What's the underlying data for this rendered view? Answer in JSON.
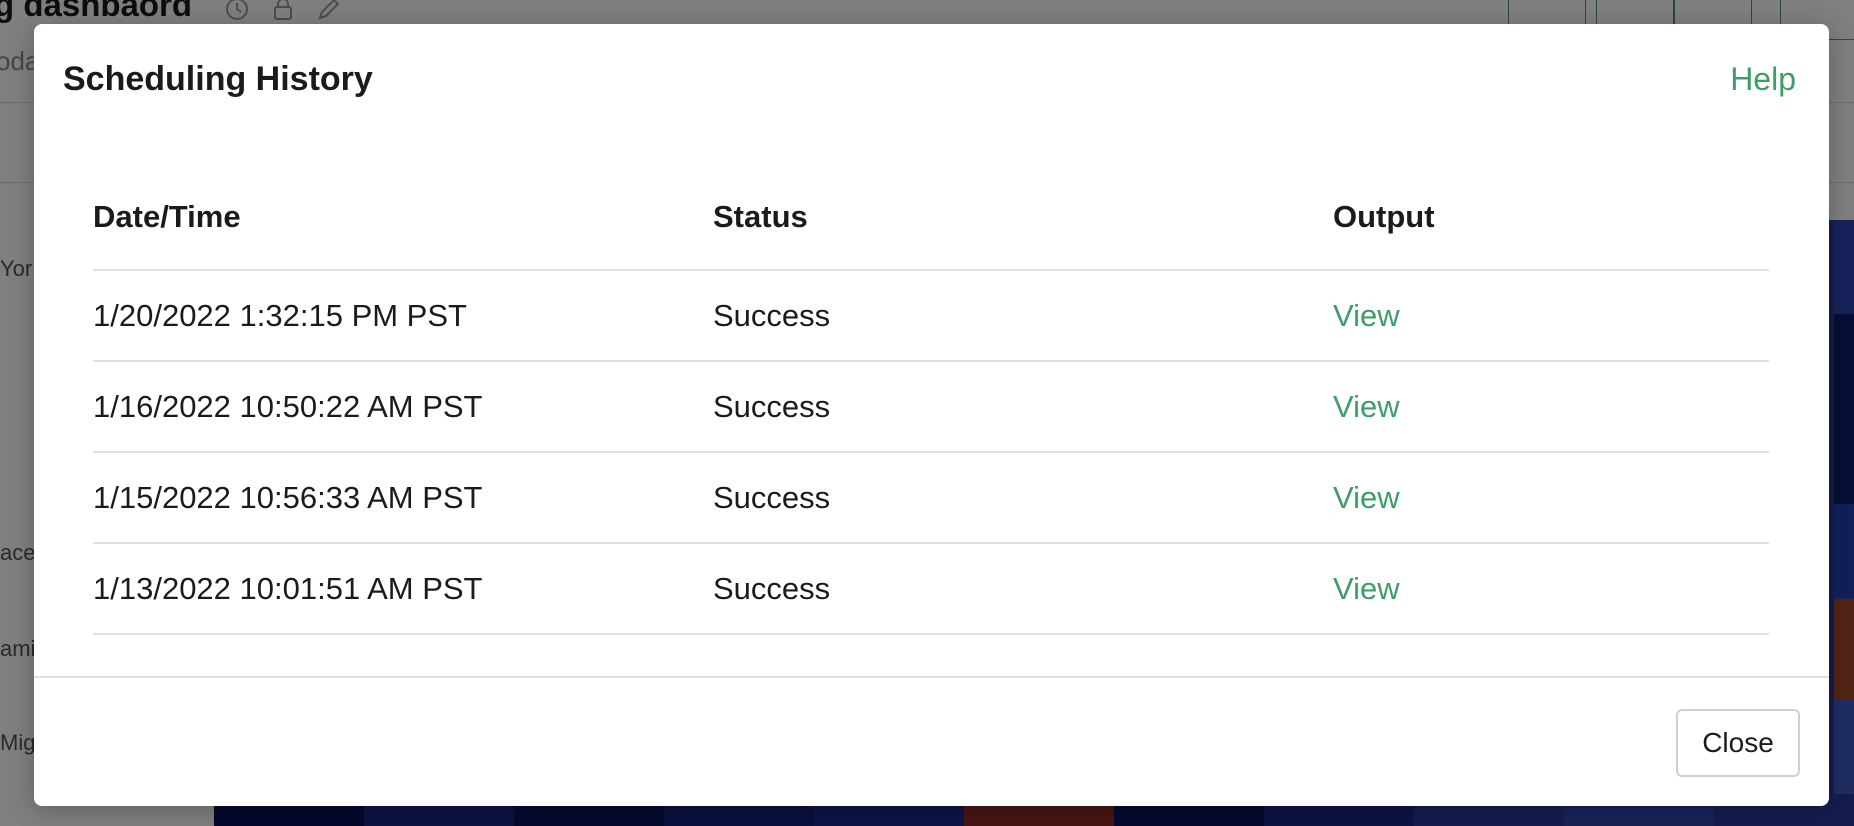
{
  "background": {
    "dashboard_title": "g dashbaord",
    "subtitle": "oda",
    "row_labels": [
      "Yor",
      "ace",
      "ami",
      "Mig"
    ]
  },
  "modal": {
    "title": "Scheduling History",
    "help_label": "Help",
    "columns": {
      "datetime": "Date/Time",
      "status": "Status",
      "output": "Output"
    },
    "rows": [
      {
        "datetime": "1/20/2022 1:32:15 PM PST",
        "status": "Success",
        "output": "View"
      },
      {
        "datetime": "1/16/2022 10:50:22 AM PST",
        "status": "Success",
        "output": "View"
      },
      {
        "datetime": "1/15/2022 10:56:33 AM PST",
        "status": "Success",
        "output": "View"
      },
      {
        "datetime": "1/13/2022 10:01:51 AM PST",
        "status": "Success",
        "output": "View"
      }
    ],
    "close_label": "Close"
  },
  "colors": {
    "accent": "#3f9d67",
    "overlay": "rgba(0,0,0,0.5)",
    "text": "#1b1b1b",
    "border": "#e0e0e0"
  },
  "icons": [
    "clock-icon",
    "lock-icon",
    "edit-icon"
  ]
}
